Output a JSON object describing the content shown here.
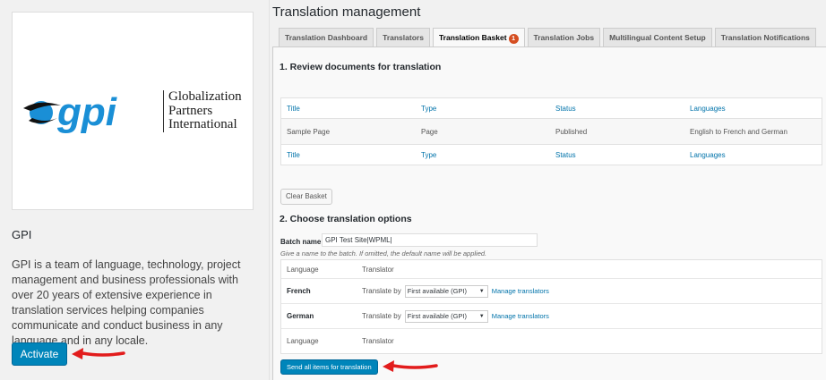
{
  "provider": {
    "logo_mark": "gpi",
    "logo_text": [
      "Globalization",
      "Partners",
      "International"
    ],
    "name": "GPI",
    "description": "GPI is a team of language, technology, project management and business professionals with over 20 years of extensive experience in translation services helping companies communicate and conduct business in any language and in any locale.",
    "activate_label": "Activate"
  },
  "wpml": {
    "title": "Translation management",
    "tabs": [
      {
        "label": "Translation Dashboard"
      },
      {
        "label": "Translators"
      },
      {
        "label": "Translation Basket",
        "badge": "1"
      },
      {
        "label": "Translation Jobs"
      },
      {
        "label": "Multilingual Content Setup"
      },
      {
        "label": "Translation Notifications"
      }
    ],
    "review_heading": "1. Review documents for translation",
    "columns": [
      "Title",
      "Type",
      "Status",
      "Languages"
    ],
    "rows": [
      [
        "Sample Page",
        "Page",
        "Published",
        "English to French and German"
      ]
    ],
    "clear_basket_label": "Clear Basket",
    "options_heading": "2. Choose translation options",
    "batch_label": "Batch name:",
    "batch_value": "GPI Test Site|WPML|",
    "batch_help": "Give a name to the batch. If omitted, the default name will be applied.",
    "options_columns": [
      "Language",
      "Translator"
    ],
    "options_rows": [
      {
        "language": "French",
        "translate_by": "Translate by",
        "selected": "First available (GPI)",
        "manage": "Manage translators"
      },
      {
        "language": "German",
        "translate_by": "Translate by",
        "selected": "First available (GPI)",
        "manage": "Manage translators"
      }
    ],
    "send_label": "Send all items for translation"
  },
  "colors": {
    "accent": "#0085ba",
    "link": "#0073aa",
    "badge": "#d54e21",
    "arrow": "#e21c1c",
    "logo_blue": "#1a8fd6"
  }
}
